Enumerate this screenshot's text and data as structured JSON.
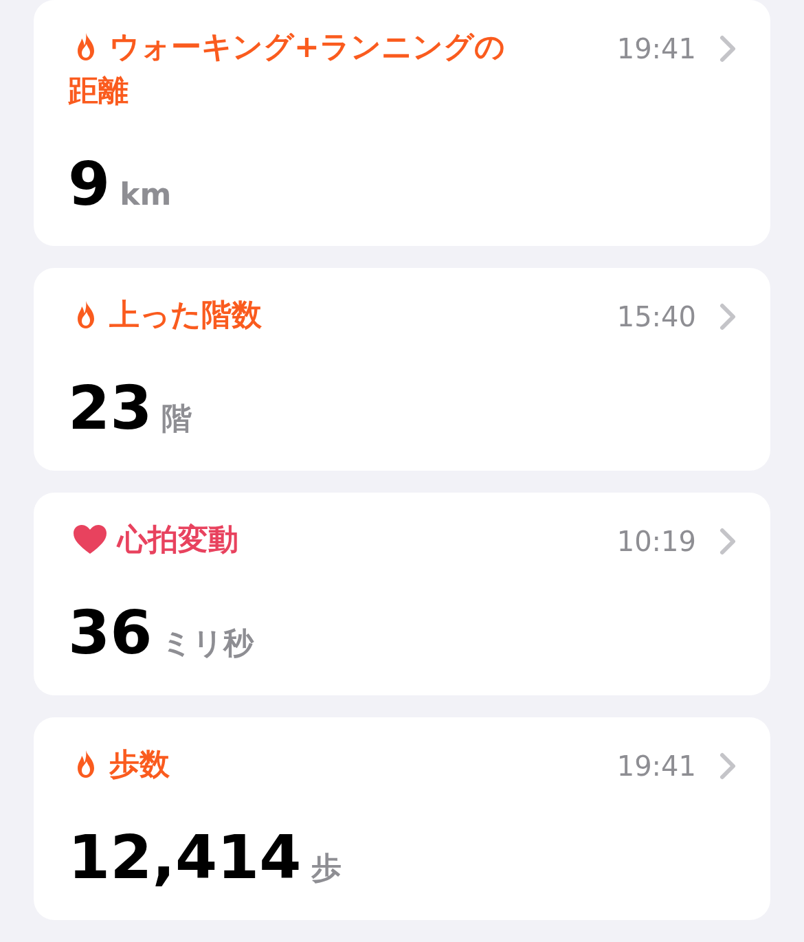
{
  "cards": [
    {
      "kind": "flame",
      "title_lines": [
        "ウォーキング+ランニングの",
        "距離"
      ],
      "time": "19:41",
      "value": "9",
      "unit": "km"
    },
    {
      "kind": "flame",
      "title_lines": [
        "上った階数"
      ],
      "time": "15:40",
      "value": "23",
      "unit": "階"
    },
    {
      "kind": "heart",
      "title_lines": [
        "心拍変動"
      ],
      "time": "10:19",
      "value": "36",
      "unit": "ミリ秒"
    },
    {
      "kind": "flame",
      "title_lines": [
        "歩数"
      ],
      "time": "19:41",
      "value": "12,414",
      "unit": "歩"
    }
  ]
}
